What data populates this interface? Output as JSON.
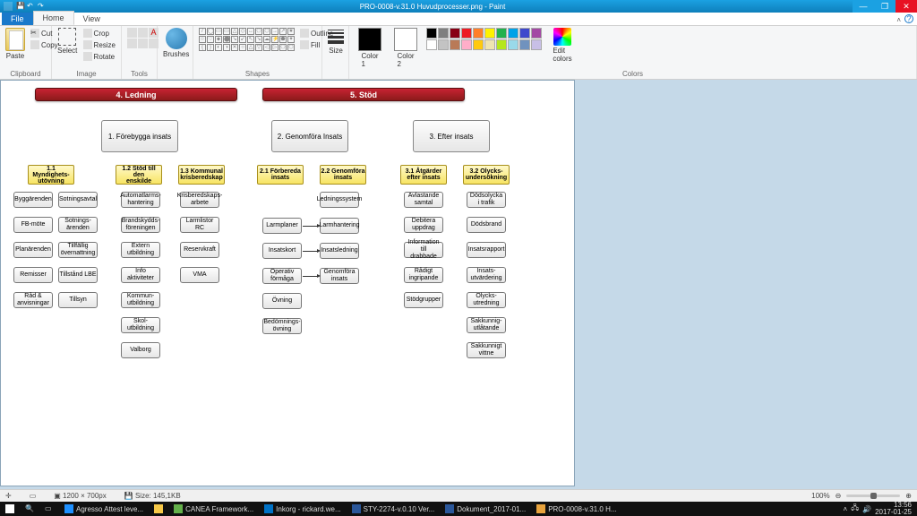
{
  "title": "PRO-0008-v.31.0 Huvudprocesser.png - Paint",
  "tabs": {
    "file": "File",
    "home": "Home",
    "view": "View"
  },
  "ribbon": {
    "clipboard": {
      "label": "Clipboard",
      "paste": "Paste",
      "cut": "Cut",
      "copy": "Copy"
    },
    "image": {
      "label": "Image",
      "select": "Select",
      "crop": "Crop",
      "resize": "Resize",
      "rotate": "Rotate"
    },
    "tools": {
      "label": "Tools"
    },
    "brushes": {
      "label": "Brushes",
      "btn": "Brushes"
    },
    "shapes": {
      "label": "Shapes",
      "outline": "Outline",
      "fill": "Fill"
    },
    "size": {
      "label": "Size"
    },
    "colors": {
      "label": "Colors",
      "c1": "Color\n1",
      "c2": "Color\n2",
      "edit": "Edit\ncolors"
    }
  },
  "palette": [
    "#000",
    "#7f7f7f",
    "#880015",
    "#ed1c24",
    "#ff7f27",
    "#fff200",
    "#22b14c",
    "#00a2e8",
    "#3f48cc",
    "#a349a4",
    "#fff",
    "#c3c3c3",
    "#b97a57",
    "#ffaec9",
    "#ffc90e",
    "#efe4b0",
    "#b5e61d",
    "#99d9ea",
    "#7092be",
    "#c8bfe7"
  ],
  "diagram": {
    "red4": "4. Ledning",
    "red5": "5. Stöd",
    "p1": "1. Förebygga insats",
    "p2": "2. Genomföra Insats",
    "p3": "3. Efter insats",
    "y11": "1.1 Myndighets-\nutövning",
    "y12": "1.2 Stöd till den\nenskilde",
    "y13": "1.3 Kommunal\nkrisberedskap",
    "y21": "2.1 Förbereda\ninsats",
    "y22": "2.2 Genomföra\ninsats",
    "y31": "3.1 Åtgärder\nefter insats",
    "y32": "3.2 Olycks-\nundersökning",
    "col11": [
      "Byggärenden",
      "FB-möte",
      "Planärenden",
      "Remisser",
      "Råd &\nanvisningar"
    ],
    "col11b": [
      "Sotningsavtal",
      "Sotnings-\närenden",
      "Tillfällig\növernattning",
      "Tillstånd LBE",
      "Tillsyn"
    ],
    "col12": [
      "Automatlarms-\nhantering",
      "Brandskydds-\nföreningen",
      "Extern\nutbildning",
      "Info\naktiviteter",
      "Kommun-\nutbildning",
      "Skol-\nutbildning",
      "Valborg"
    ],
    "col13": [
      "Krisberedskaps-\narbete",
      "Larmlistor RC",
      "Reservkraft",
      "VMA"
    ],
    "col21": [
      "Larmplaner",
      "Insatskort",
      "Operativ\nförmåga",
      "Övning",
      "Bedömnings-\növning"
    ],
    "col22top": "Ledningssystem",
    "col22": [
      "Larmhantering",
      "Insatsledning",
      "Genomföra\ninsats"
    ],
    "col31": [
      "Avlastande\nsamtal",
      "Debitera\nuppdrag",
      "Information till\ndrabbade",
      "Rådigt\ningripande",
      "Stödgrupper"
    ],
    "col32": [
      "Dödsolycka\ni trafik",
      "Dödsbrand",
      "Insatsrapport",
      "Insats-\nutvärdering",
      "Olycks-\nutredning",
      "Sakkunnig-\nutlåtande",
      "Sakkunnigt\nvittne"
    ]
  },
  "status": {
    "pos": "",
    "dim": "1200 × 700px",
    "size": "Size: 145,1KB",
    "zoom": "100%"
  },
  "taskbar": {
    "items": [
      "Agresso Attest leve...",
      "",
      "CANEA Framework...",
      "Inkorg - rickard.we...",
      "STY-2274-v.0.10 Ver...",
      "Dokument_2017-01...",
      "PRO-0008-v.31.0 H..."
    ],
    "time": "13:56",
    "date": "2017-01-25"
  }
}
